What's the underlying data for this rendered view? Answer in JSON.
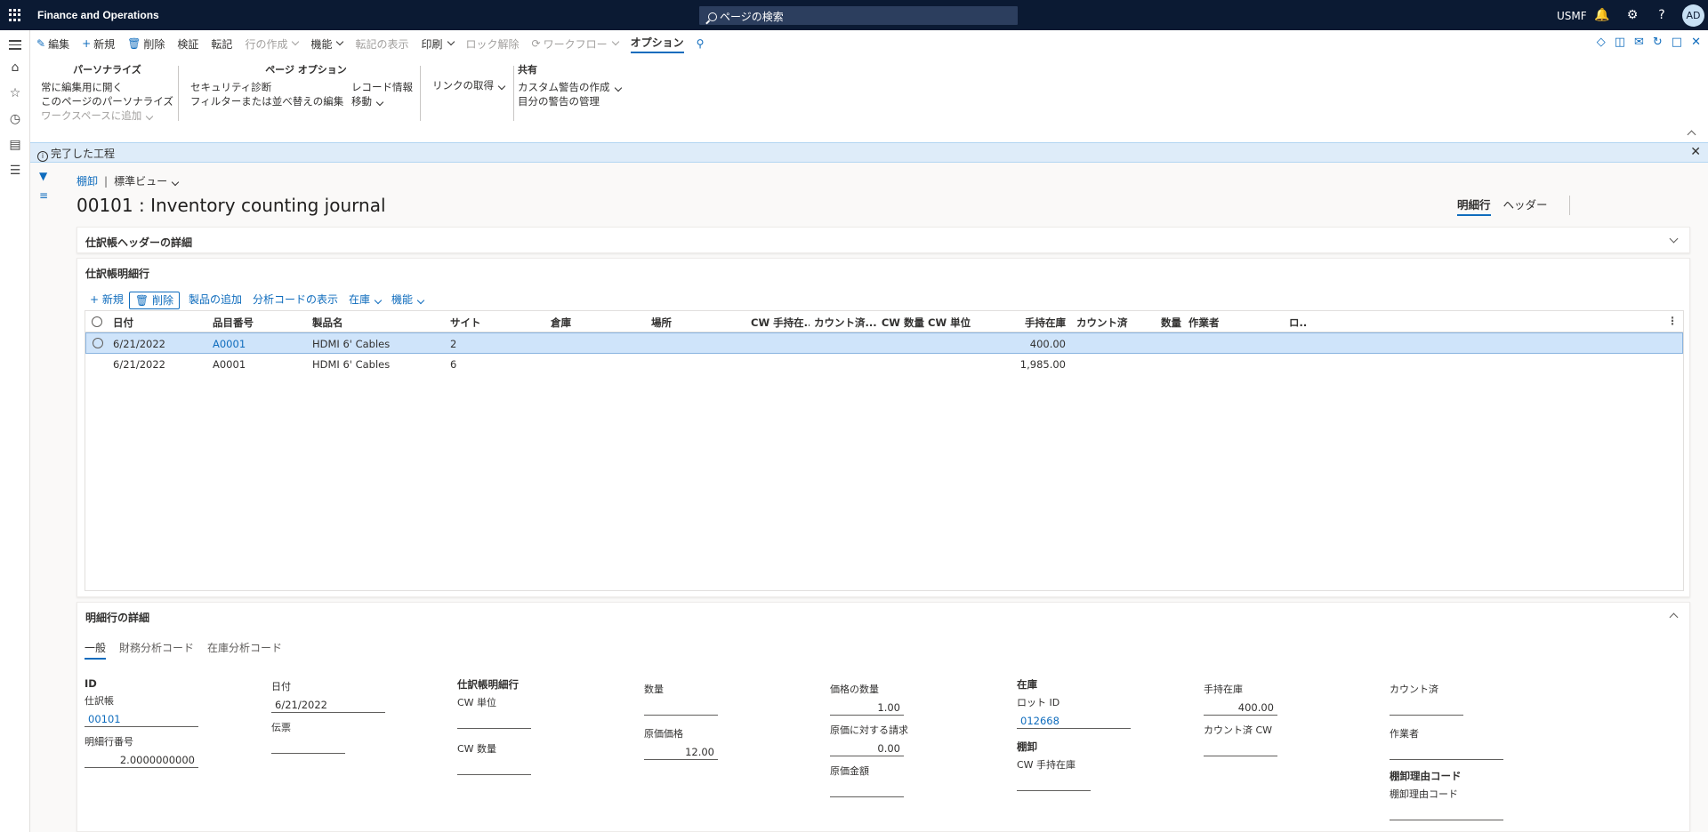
{
  "topbar": {
    "app_title": "Finance and Operations",
    "search_placeholder": "ページの検索",
    "company": "USMF",
    "avatar_initials": "AD"
  },
  "actions": [
    {
      "label": "編集",
      "icon": "pencil-icon",
      "disabled": false
    },
    {
      "label": "新規",
      "icon": "plus-icon",
      "disabled": false
    },
    {
      "label": "削除",
      "icon": "trash-icon",
      "disabled": false
    },
    {
      "label": "検証",
      "disabled": false
    },
    {
      "label": "転記",
      "disabled": false
    },
    {
      "label": "行の作成",
      "disabled": true,
      "dropdown": true
    },
    {
      "label": "機能",
      "disabled": false,
      "dropdown": true
    },
    {
      "label": "転記の表示",
      "disabled": true
    },
    {
      "label": "印刷",
      "disabled": false,
      "dropdown": true
    },
    {
      "label": "ロック解除",
      "disabled": true
    },
    {
      "label": "ワークフロー",
      "disabled": true,
      "dropdown": true
    },
    {
      "label": "オプション",
      "active": true
    }
  ],
  "ribbon": {
    "personalize": {
      "header": "パーソナライズ",
      "items": [
        "常に編集用に開く",
        "このページのパーソナライズ",
        "ワークスペースに追加"
      ]
    },
    "page_options": {
      "header": "ページ オプション",
      "items": [
        "セキュリティ診断",
        "フィルターまたは並べ替えの編集",
        "レコード情報",
        "移動"
      ]
    },
    "link": {
      "items": [
        "リンクの取得"
      ]
    },
    "share": {
      "header": "共有",
      "items": [
        "カスタム警告の作成",
        "目分の警告の管理"
      ]
    }
  },
  "message": {
    "text": "完了した工程"
  },
  "page": {
    "breadcrumb": "棚卸",
    "view": "標準ビュー",
    "title": "00101 : Inventory counting journal",
    "tabs": [
      "明細行",
      "ヘッダー"
    ]
  },
  "header_card": {
    "title": "仕訳帳ヘッダーの詳細"
  },
  "lines_card": {
    "title": "仕訳帳明細行",
    "toolbar": [
      "新規",
      "削除",
      "製品の追加",
      "分析コードの表示",
      "在庫",
      "機能"
    ],
    "columns": [
      "日付",
      "品目番号",
      "製品名",
      "サイト",
      "倉庫",
      "場所",
      "CW 手持在...",
      "カウント済...",
      "CW 数量",
      "CW 単位",
      "手持在庫",
      "カウント済",
      "数量",
      "作業者",
      "ロ.."
    ],
    "rows": [
      {
        "date": "6/21/2022",
        "item": "A0001",
        "name": "HDMI 6' Cables",
        "site": "2",
        "onhand": "400.00",
        "selected": true
      },
      {
        "date": "6/21/2022",
        "item": "A0001",
        "name": "HDMI 6' Cables",
        "site": "6",
        "onhand": "1,985.00",
        "selected": false
      }
    ]
  },
  "details_card": {
    "title": "明細行の詳細",
    "tabs": [
      "一般",
      "財務分析コード",
      "在庫分析コード"
    ],
    "id_group": {
      "header": "ID",
      "journal_label": "仕訳帳",
      "journal_value": "00101",
      "line_label": "明細行番号",
      "line_value": "2.0000000000"
    },
    "date_group": {
      "date_label": "日付",
      "date_value": "6/21/2022",
      "voucher_label": "伝票",
      "voucher_value": ""
    },
    "line_group": {
      "header": "仕訳帳明細行",
      "cw_unit_label": "CW 単位",
      "cw_qty_label": "CW 数量"
    },
    "qty_group": {
      "qty_label": "数量",
      "cost_label": "原価価格",
      "cost_value": "12.00"
    },
    "price_group": {
      "price_qty_label": "価格の数量",
      "price_qty_value": "1.00",
      "charge_label": "原価に対する請求",
      "charge_value": "0.00",
      "amount_label": "原価金額"
    },
    "inventory_group": {
      "header": "在庫",
      "lot_label": "ロット ID",
      "lot_value": "012668",
      "count_header": "棚卸",
      "cw_onhand_label": "CW 手持在庫"
    },
    "onhand_group": {
      "onhand_label": "手持在庫",
      "onhand_value": "400.00",
      "counted_cw_label": "カウント済 CW"
    },
    "counted_group": {
      "counted_label": "カウント済",
      "worker_label": "作業者",
      "reason_header": "棚卸理由コード",
      "reason_label": "棚卸理由コード"
    }
  }
}
